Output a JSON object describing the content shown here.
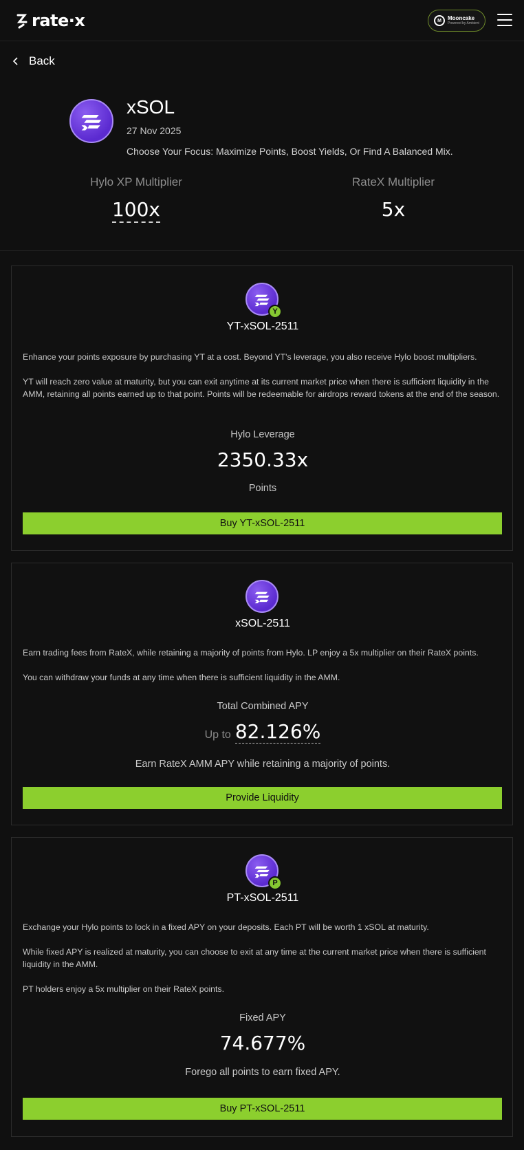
{
  "header": {
    "logo_text": "rate·x",
    "partner": {
      "title": "Mooncake",
      "subtitle": "Powered by Ambient",
      "icon_text": "M"
    }
  },
  "nav": {
    "back_label": "Back"
  },
  "hero": {
    "title": "xSOL",
    "date": "27 Nov 2025",
    "description": "Choose Your Focus: Maximize Points, Boost Yields, Or Find A Balanced Mix.",
    "multipliers": [
      {
        "label": "Hylo XP Multiplier",
        "value": "100x"
      },
      {
        "label": "RateX Multiplier",
        "value": "5x"
      }
    ]
  },
  "cards": {
    "yt": {
      "badge": "Y",
      "name": "YT-xSOL-2511",
      "paragraphs": [
        "Enhance your points exposure by purchasing YT at a cost. Beyond YT's leverage, you also receive Hylo boost multipliers.",
        "YT will reach zero value at maturity, but you can exit anytime at its current market price when there is sufficient liquidity in the AMM, retaining all points earned up to that point. Points will be redeemable for airdrops reward tokens at the end of the season."
      ],
      "metric_label": "Hylo Leverage",
      "metric_value": "2350.33x",
      "metric_sub": "Points",
      "button_label": "Buy YT-xSOL-2511"
    },
    "lp": {
      "name": "xSOL-2511",
      "paragraphs": [
        "Earn trading fees from RateX, while retaining a majority of points from Hylo. LP enjoy a 5x multiplier on their RateX points.",
        "You can withdraw your funds at any time when there is sufficient liquidity in the AMM."
      ],
      "metric_label": "Total Combined APY",
      "metric_prefix": "Up to",
      "metric_value": "82.126%",
      "metric_sub": "Earn RateX AMM APY while retaining a majority of points.",
      "button_label": "Provide Liquidity"
    },
    "pt": {
      "badge": "P",
      "name": "PT-xSOL-2511",
      "paragraphs": [
        "Exchange your Hylo points to lock in a fixed APY on your deposits. Each PT will be worth 1 xSOL at maturity.",
        "While fixed APY is realized at maturity, you can choose to exit at any time at the current market price when there is sufficient liquidity in the AMM.",
        "PT holders enjoy a 5x multiplier on their RateX points."
      ],
      "metric_label": "Fixed APY",
      "metric_value": "74.677%",
      "metric_sub": "Forego all points to earn fixed APY.",
      "button_label": "Buy PT-xSOL-2511"
    }
  },
  "colors": {
    "accent": "#8ccf2e",
    "background": "#101010",
    "token": "#6a3be0"
  }
}
